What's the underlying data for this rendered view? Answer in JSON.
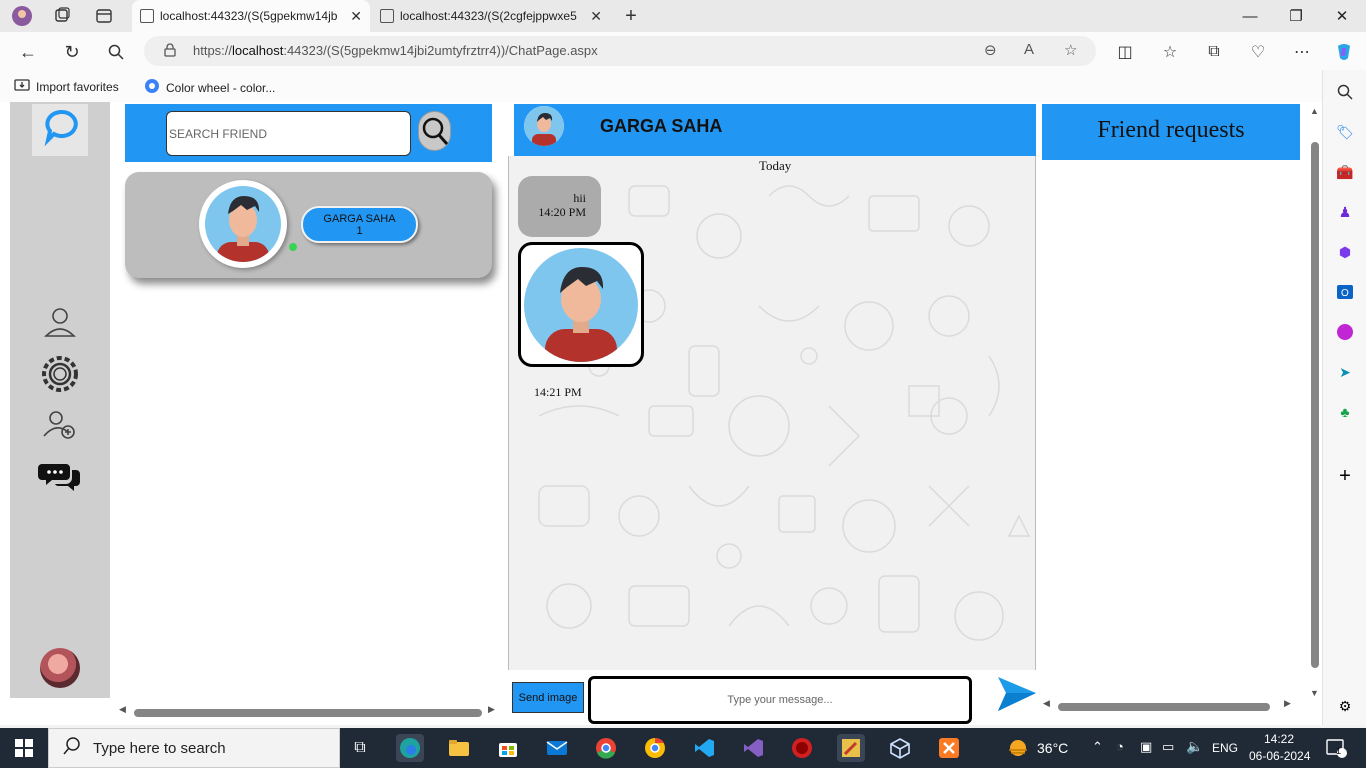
{
  "browser": {
    "tabs": [
      {
        "title": "localhost:44323/(S(5gpekmw14jb",
        "active": true
      },
      {
        "title": "localhost:44323/(S(2cgfejppwxe5",
        "active": false
      }
    ],
    "url_prefix": "https://",
    "url_host": "localhost",
    "url_rest": ":44323/(S(5gpekmw14jbi2umtyfrztrr4))/ChatPage.aspx",
    "favorites": [
      {
        "label": "Import favorites",
        "icon": "import-icon"
      },
      {
        "label": "Color wheel - color...",
        "icon": "color-wheel-icon"
      }
    ]
  },
  "sidebar": {
    "items": [
      "profile-icon",
      "settings-icon",
      "add-friend-icon",
      "chat-icon"
    ]
  },
  "friends": {
    "search_placeholder": "SEARCH FRIEND",
    "list": [
      {
        "name": "GARGA SAHA",
        "unread": "1",
        "online": true
      }
    ]
  },
  "chat": {
    "contact_name": "GARGA SAHA",
    "date_separator": "Today",
    "messages": [
      {
        "type": "text",
        "text": "hii",
        "time": "14:20 PM"
      },
      {
        "type": "image",
        "time": "14:21 PM"
      }
    ],
    "send_image_label": "Send image",
    "input_placeholder": "Type your message..."
  },
  "requests": {
    "title": "Friend requests"
  },
  "taskbar": {
    "search_placeholder": "Type here to search",
    "weather": "36°C",
    "language": "ENG",
    "time": "14:22",
    "date": "06-06-2024",
    "notification_count": "1"
  },
  "colors": {
    "accent": "#2196f3",
    "sidebar": "#cfcfcf",
    "card": "#bdbdbd",
    "online": "#39d353"
  }
}
